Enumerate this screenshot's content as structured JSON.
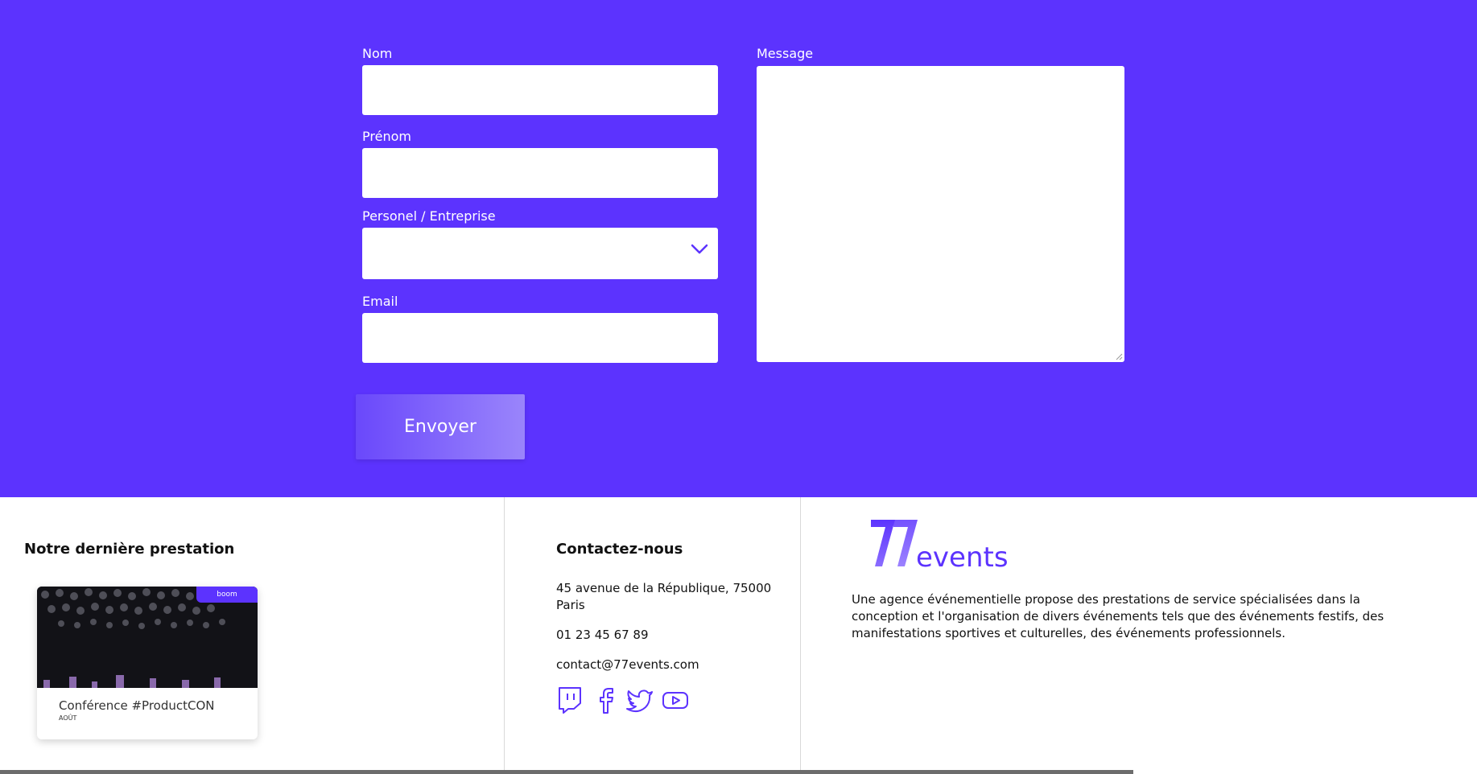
{
  "form": {
    "nom_label": "Nom",
    "prenom_label": "Prénom",
    "type_label": "Personel / Entreprise",
    "email_label": "Email",
    "message_label": "Message",
    "submit_label": "Envoyer",
    "nom_value": "",
    "prenom_value": "",
    "type_value": "",
    "email_value": "",
    "message_value": ""
  },
  "footer": {
    "latest": {
      "title": "Notre dernière prestation",
      "card": {
        "badge": "boom",
        "title": "Conférence #ProductCON",
        "subtitle": "AOÛT"
      }
    },
    "contact": {
      "title": "Contactez-nous",
      "address_line1": "45 avenue de la République, 75000",
      "address_line2": "Paris",
      "phone": "01 23 45 67 89",
      "email": "contact@77events.com",
      "social_icons": [
        "twitch-icon",
        "facebook-icon",
        "twitter-icon",
        "youtube-icon"
      ]
    },
    "about": {
      "logo_text": "77events",
      "description": "Une agence événementielle propose des prestations de service spécialisées dans la conception et l'organisation de divers événements tels que des événements festifs, des manifestations sportives et culturelles, des événements professionnels."
    }
  },
  "colors": {
    "primary": "#5c33fe",
    "button_gradient_start": "#6a48fb",
    "button_gradient_end": "#9a85fb",
    "divider": "#d9d9d9"
  }
}
